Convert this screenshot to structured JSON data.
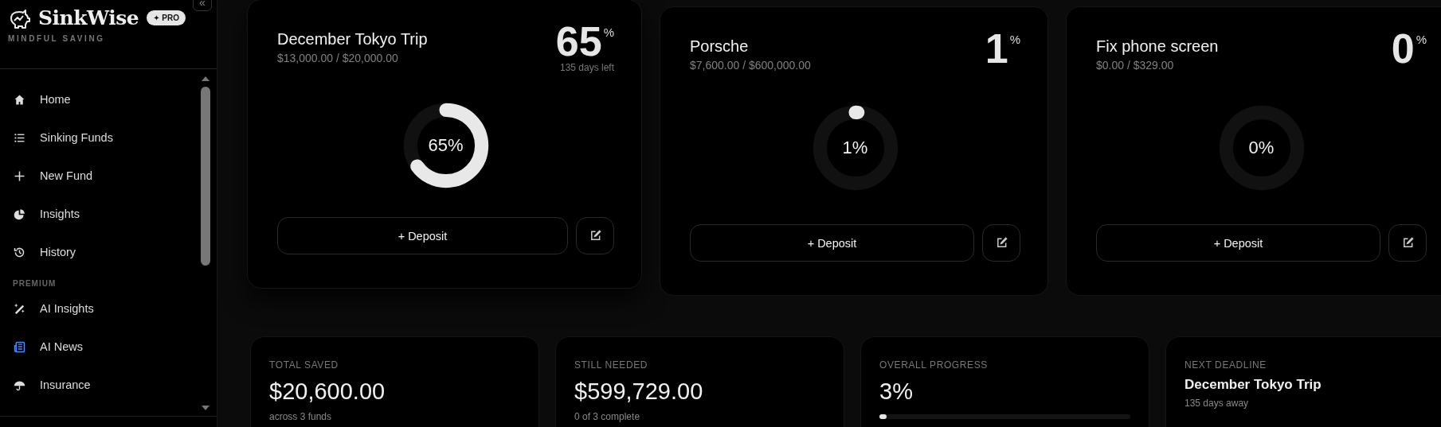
{
  "sidebar": {
    "brand": "SinkWise",
    "badge": "✦ PRO",
    "tagline": "MINDFUL SAVING",
    "collapse": "«",
    "items": [
      {
        "label": "Home",
        "selected": false
      },
      {
        "label": "Sinking Funds",
        "selected": false
      },
      {
        "label": "New Fund",
        "selected": false
      },
      {
        "label": "Insights",
        "selected": false
      },
      {
        "label": "History",
        "selected": false
      }
    ],
    "section": "PREMIUM",
    "premium_items": [
      {
        "label": "AI Insights",
        "selected": false
      },
      {
        "label": "AI News",
        "selected": false
      },
      {
        "label": "Insurance",
        "selected": false
      }
    ]
  },
  "funds": [
    {
      "title": "December Tokyo Trip",
      "amount": "$13,000.00 / $20,000.00",
      "percent": "65",
      "unit": "%",
      "days": "135 days left",
      "ring_label": "65%",
      "raised": true,
      "deposit": "+ Deposit"
    },
    {
      "title": "Porsche",
      "amount": "$7,600.00 / $600,000.00",
      "percent": "1",
      "unit": "%",
      "ring_label": "1%",
      "raised": false,
      "deposit": "+ Deposit"
    },
    {
      "title": "Fix phone screen",
      "amount": "$0.00 / $329.00",
      "percent": "0",
      "unit": "%",
      "ring_label": "0%",
      "raised": false,
      "deposit": "+ Deposit"
    }
  ],
  "stats": [
    {
      "kind": "amount",
      "label": "TOTAL SAVED",
      "value": "$20,600.00",
      "note": "across 3 funds"
    },
    {
      "kind": "amount",
      "label": "STILL NEEDED",
      "value": "$599,729.00",
      "note": "0 of 3 complete"
    },
    {
      "kind": "progress",
      "label": "OVERALL PROGRESS",
      "value": "3%",
      "level": 0.03
    },
    {
      "kind": "deadline",
      "label": "NEXT DEADLINE",
      "value": "December Tokyo Trip",
      "note": "135 days away"
    }
  ]
}
